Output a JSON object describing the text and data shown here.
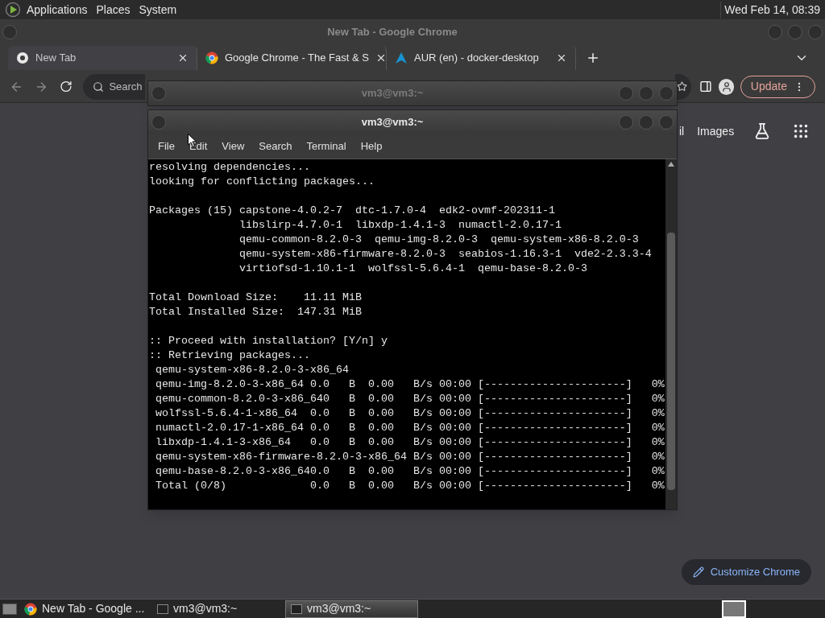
{
  "top_panel": {
    "menus": [
      "Applications",
      "Places",
      "System"
    ],
    "clock": "Wed Feb 14, 08:39"
  },
  "browser": {
    "window_title": "New Tab - Google Chrome",
    "tabs": [
      {
        "title": "New Tab",
        "kind": "newtab",
        "selected": true
      },
      {
        "title": "Google Chrome - The Fast & S",
        "kind": "chrome",
        "selected": false
      },
      {
        "title": "AUR (en) - docker-desktop",
        "kind": "arch",
        "selected": false
      }
    ],
    "search_placeholder": "Search",
    "update_label": "Update",
    "links": [
      "il",
      "Images"
    ],
    "customize_label": "Customize Chrome"
  },
  "terminals": [
    {
      "title": "vm3@vm3:~",
      "focused": false
    },
    {
      "title": "vm3@vm3:~",
      "focused": true,
      "menu": [
        "File",
        "Edit",
        "View",
        "Search",
        "Terminal",
        "Help"
      ],
      "blocks": [
        [
          "resolving dependencies...",
          "looking for conflicting packages..."
        ],
        [
          "Packages (15) capstone-4.0.2-7  dtc-1.7.0-4  edk2-ovmf-202311-1",
          "              libslirp-4.7.0-1  libxdp-1.4.1-3  numactl-2.0.17-1",
          "              qemu-common-8.2.0-3  qemu-img-8.2.0-3  qemu-system-x86-8.2.0-3",
          "              qemu-system-x86-firmware-8.2.0-3  seabios-1.16.3-1  vde2-2.3.3-4",
          "              virtiofsd-1.10.1-1  wolfssl-5.6.4-1  qemu-base-8.2.0-3"
        ],
        [
          "Total Download Size:    11.11 MiB",
          "Total Installed Size:  147.31 MiB"
        ],
        [
          ":: Proceed with installation? [Y/n] y",
          ":: Retrieving packages...",
          " qemu-system-x86-8.2.0-3-x86_64",
          " qemu-img-8.2.0-3-x86_64 0.0   B  0.00   B/s 00:00 [----------------------]   0%",
          " qemu-common-8.2.0-3-x86_640   B  0.00   B/s 00:00 [----------------------]   0%",
          " wolfssl-5.6.4-1-x86_64  0.0   B  0.00   B/s 00:00 [----------------------]   0%",
          " numactl-2.0.17-1-x86_64 0.0   B  0.00   B/s 00:00 [----------------------]   0%",
          " libxdp-1.4.1-3-x86_64   0.0   B  0.00   B/s 00:00 [----------------------]   0%",
          " qemu-system-x86-firmware-8.2.0-3-x86_64 B/s 00:00 [----------------------]   0%",
          " qemu-base-8.2.0-3-x86_640.0   B  0.00   B/s 00:00 [----------------------]   0%",
          " Total (0/8)             0.0   B  0.00   B/s 00:00 [----------------------]   0%"
        ]
      ]
    }
  ],
  "taskbar": [
    {
      "label": "New Tab - Google ...",
      "kind": "browser",
      "selected": false
    },
    {
      "label": "vm3@vm3:~",
      "kind": "terminal",
      "selected": false
    },
    {
      "label": "vm3@vm3:~",
      "kind": "terminal",
      "selected": true
    }
  ]
}
